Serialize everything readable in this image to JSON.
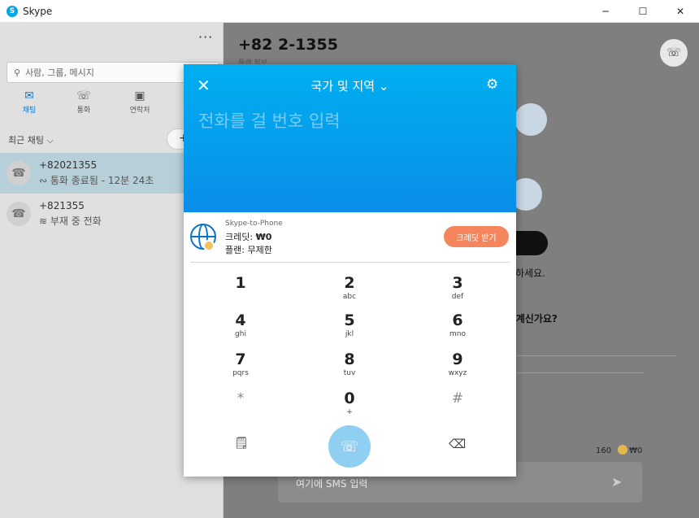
{
  "window": {
    "title": "Skype",
    "minimize": "─",
    "maximize": "☐",
    "close": "✕"
  },
  "sidebar": {
    "more": "···",
    "search_placeholder": "사람, 그룹, 메시지",
    "tabs": [
      {
        "label": "채팅",
        "icon": "chat-icon"
      },
      {
        "label": "통화",
        "icon": "phone-icon"
      },
      {
        "label": "연락처",
        "icon": "contacts-icon"
      }
    ],
    "recent_label": "최근 채팅 ⌵",
    "new_chat": "+",
    "chats": [
      {
        "name": "+82021355",
        "status": "통화 종료됨 - 12분 24초"
      },
      {
        "name": "+821355",
        "status": "부재 중 전화"
      }
    ]
  },
  "main": {
    "title": "+82 2-1355",
    "subtitle": "플랜 정보",
    "partial_text_1": "하세요.",
    "partial_text_2": ". 계신가요?",
    "sms_placeholder": "여기에 SMS 입력",
    "char_count": "160",
    "credit_small": "₩0"
  },
  "dialer": {
    "country_label": "국가 및 지역",
    "number_placeholder": "전화를 걸 번호 입력",
    "product": "Skype-to-Phone",
    "credit_label": "크레딧: ",
    "credit_value": "₩0",
    "plan_label": "플랜: ",
    "plan_value": "무제한",
    "get_credit_button": "크레딧 받기",
    "keys": [
      {
        "digit": "1",
        "letters": ""
      },
      {
        "digit": "2",
        "letters": "abc"
      },
      {
        "digit": "3",
        "letters": "def"
      },
      {
        "digit": "4",
        "letters": "ghi"
      },
      {
        "digit": "5",
        "letters": "jkl"
      },
      {
        "digit": "6",
        "letters": "mno"
      },
      {
        "digit": "7",
        "letters": "pqrs"
      },
      {
        "digit": "8",
        "letters": "tuv"
      },
      {
        "digit": "9",
        "letters": "wxyz"
      },
      {
        "digit": "*",
        "letters": ""
      },
      {
        "digit": "0",
        "letters": "+"
      },
      {
        "digit": "#",
        "letters": ""
      }
    ]
  },
  "colors": {
    "accent": "#00aff0",
    "credit_button": "#f4855c",
    "call_button": "#8fd0f2"
  }
}
